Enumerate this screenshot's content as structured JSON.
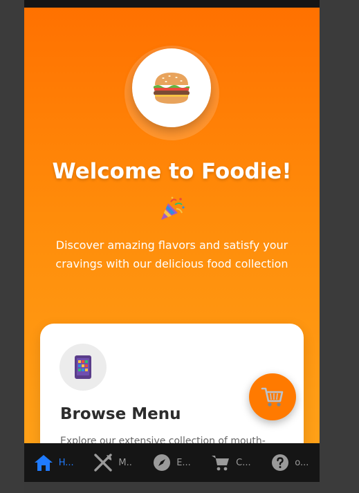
{
  "hero": {
    "title": "Welcome to Foodie!",
    "subtitle": "Discover amazing flavors and satisfy your cravings with our delicious food collection",
    "icon": "burger-icon",
    "emoji": "party-popper-icon"
  },
  "card": {
    "title": "Browse Menu",
    "description": "Explore our extensive collection of mouth-",
    "icon": "menu-tablet-icon"
  },
  "fab": {
    "icon": "shopping-cart-icon"
  },
  "nav": {
    "items": [
      {
        "label": "H...",
        "icon": "home-icon",
        "active": true
      },
      {
        "label": "M..",
        "icon": "utensils-icon",
        "active": false
      },
      {
        "label": "E...",
        "icon": "compass-icon",
        "active": false
      },
      {
        "label": "C...",
        "icon": "cart-icon",
        "active": false
      },
      {
        "label": "o...",
        "icon": "help-icon",
        "active": false
      }
    ]
  },
  "colors": {
    "accent": "#ff7a00",
    "active_nav": "#1f7bff",
    "nav_bg": "#151515"
  }
}
